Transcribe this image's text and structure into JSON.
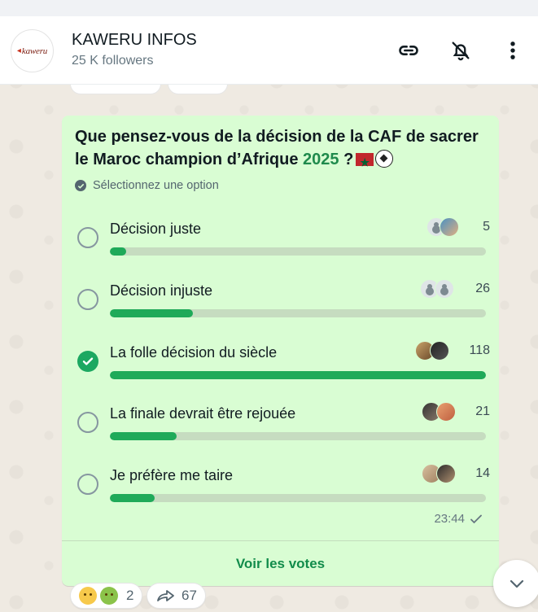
{
  "header": {
    "avatar_text": "kaweru",
    "channel_name": "KAWERU INFOS",
    "followers": "25 K followers",
    "icons": [
      "link-icon",
      "bell-off-icon",
      "more-vert-icon"
    ]
  },
  "poll": {
    "question_main": "Que pensez-vous de la décision de la CAF de sacrer le Maroc champion d’Afrique ",
    "question_year": "2025",
    "question_suffix": " ?",
    "select_hint": "Sélectionnez une option",
    "max_votes": 118,
    "options": [
      {
        "label": "Décision juste",
        "count": "5",
        "votes": 5,
        "selected": false
      },
      {
        "label": "Décision injuste",
        "count": "26",
        "votes": 26,
        "selected": false
      },
      {
        "label": "La folle décision du siècle",
        "count": "118",
        "votes": 118,
        "selected": true
      },
      {
        "label": "La finale devrait être rejouée",
        "count": "21",
        "votes": 21,
        "selected": false
      },
      {
        "label": "Je préfère me taire",
        "count": "14",
        "votes": 14,
        "selected": false
      }
    ],
    "time": "23:44",
    "see_votes": "Voir les votes"
  },
  "reactions": {
    "emojis": [
      "disappointed-face",
      "nauseated-face"
    ],
    "count": "2",
    "forward_count": "67"
  },
  "colors": {
    "bubble": "#d9fdd3",
    "accent": "#1faa59",
    "link": "#128c4b"
  }
}
